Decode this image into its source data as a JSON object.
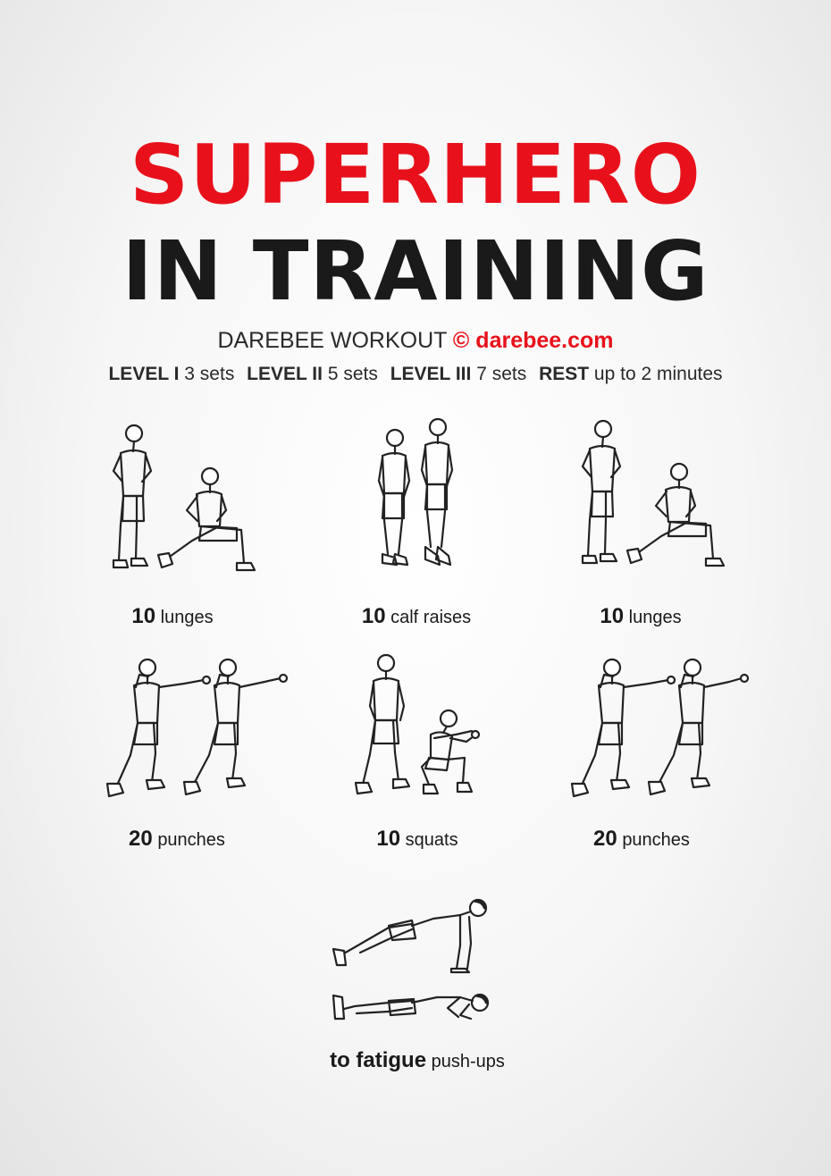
{
  "header": {
    "title_line1": "SUPERHERO",
    "title_line2": "IN TRAINING",
    "workout_label": "DAREBEE WORKOUT",
    "copyright_symbol": "©",
    "site": "darebee.com",
    "accent_color": "#e8111b"
  },
  "levels": [
    {
      "name": "LEVEL I",
      "value": "3 sets"
    },
    {
      "name": "LEVEL II",
      "value": "5 sets"
    },
    {
      "name": "LEVEL III",
      "value": "7 sets"
    },
    {
      "name": "REST",
      "value": "up to 2 minutes"
    }
  ],
  "exercises": [
    {
      "count": "10",
      "name": "lunges",
      "icon": "lunge-figure"
    },
    {
      "count": "10",
      "name": "calf raises",
      "icon": "calf-raise-figure"
    },
    {
      "count": "10",
      "name": "lunges",
      "icon": "lunge-figure"
    },
    {
      "count": "20",
      "name": "punches",
      "icon": "punch-figure"
    },
    {
      "count": "10",
      "name": "squats",
      "icon": "squat-figure"
    },
    {
      "count": "20",
      "name": "punches",
      "icon": "punch-figure"
    },
    {
      "count": "to fatigue",
      "name": "push-ups",
      "icon": "push-up-figure"
    }
  ]
}
